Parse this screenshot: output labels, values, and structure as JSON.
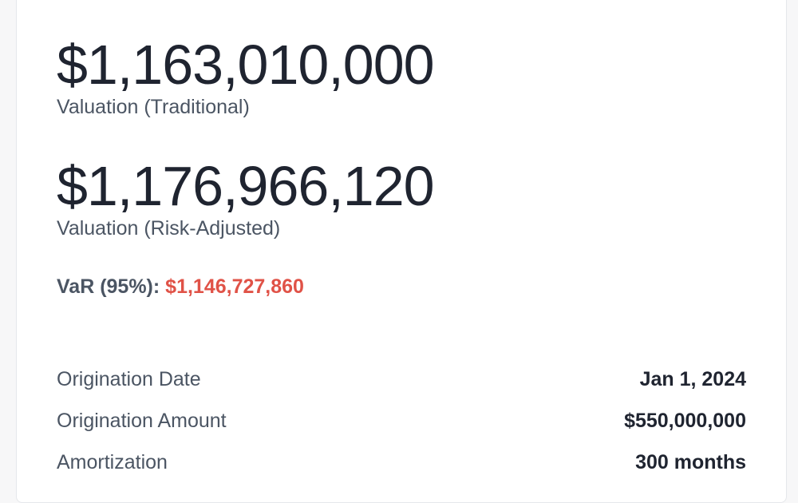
{
  "valuation": {
    "traditional": {
      "value": "$1,163,010,000",
      "label": "Valuation (Traditional)"
    },
    "risk_adjusted": {
      "value": "$1,176,966,120",
      "label": "Valuation (Risk-Adjusted)"
    },
    "var": {
      "label": "VaR (95%):",
      "value": "$1,146,727,860"
    }
  },
  "details": [
    {
      "label": "Origination Date",
      "value": "Jan 1, 2024"
    },
    {
      "label": "Origination Amount",
      "value": "$550,000,000"
    },
    {
      "label": "Amortization",
      "value": "300 months"
    }
  ],
  "colors": {
    "var_value": "#e05247",
    "primary_text": "#1f2430",
    "secondary_text": "#4b5563"
  }
}
